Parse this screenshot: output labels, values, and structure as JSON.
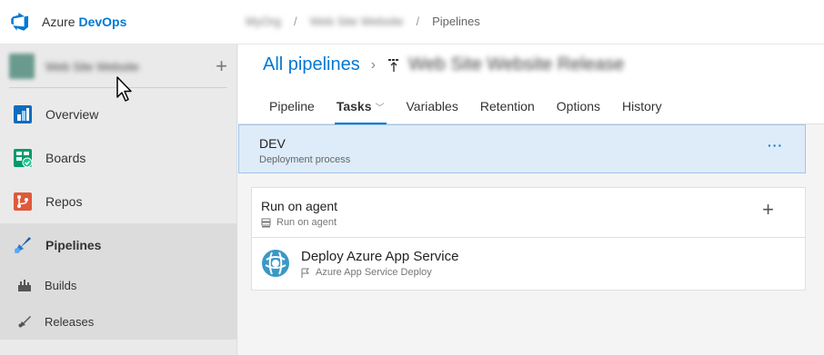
{
  "header": {
    "brand_prefix": "Azure",
    "brand_name": "DevOps",
    "breadcrumbs": [
      "MyOrg",
      "Web Site Website",
      "Pipelines"
    ]
  },
  "sidebar": {
    "project_name": "Web Site Website",
    "add_symbol": "+",
    "items": [
      {
        "label": "Overview",
        "icon": "overview-icon"
      },
      {
        "label": "Boards",
        "icon": "boards-icon"
      },
      {
        "label": "Repos",
        "icon": "repos-icon"
      },
      {
        "label": "Pipelines",
        "icon": "pipelines-icon"
      },
      {
        "label": "Builds",
        "icon": "builds-icon"
      },
      {
        "label": "Releases",
        "icon": "releases-icon"
      }
    ]
  },
  "main": {
    "breadcrumb_root": "All pipelines",
    "pipeline_name": "Web Site Website Release",
    "tabs": [
      "Pipeline",
      "Tasks",
      "Variables",
      "Retention",
      "Options",
      "History"
    ],
    "stage": {
      "name": "DEV",
      "subtitle": "Deployment process",
      "more": "···"
    },
    "job": {
      "name": "Run on agent",
      "subtitle": "Run on agent",
      "add": "+"
    },
    "task": {
      "name": "Deploy Azure App Service",
      "subtitle": "Azure App Service Deploy"
    }
  },
  "colors": {
    "accent": "#0078d4",
    "stage_bg": "#deecf9"
  }
}
